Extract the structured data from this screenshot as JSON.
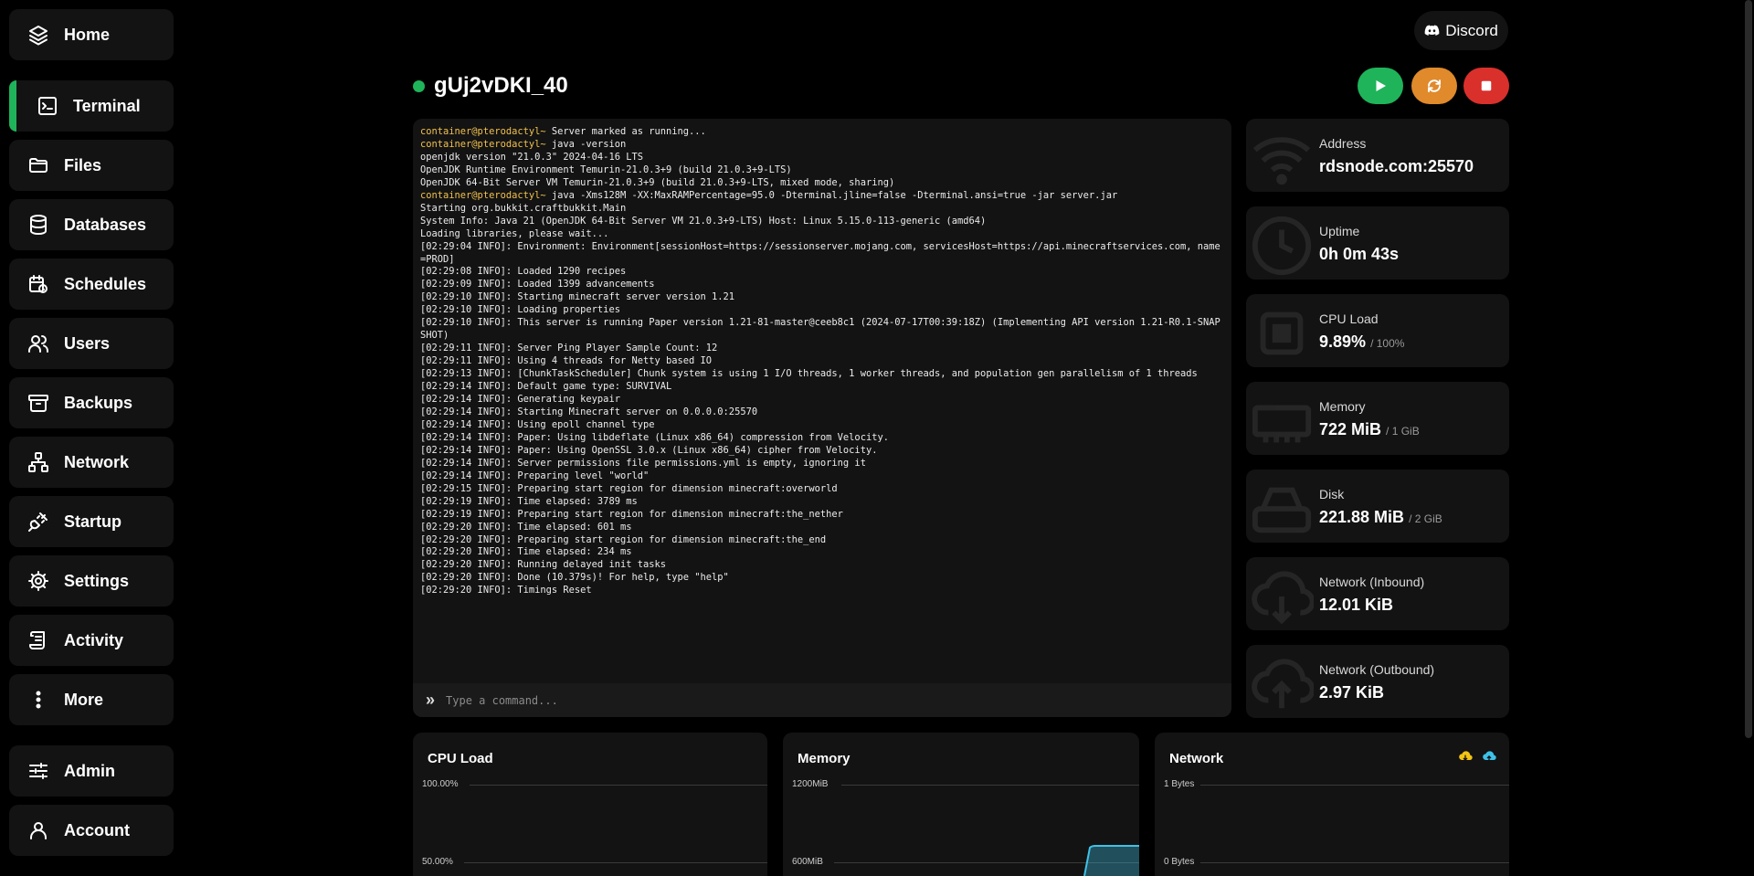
{
  "sidebar": {
    "items": [
      {
        "label": "Home",
        "icon": "layers-icon"
      },
      {
        "label": "Terminal",
        "icon": "terminal-icon",
        "active": true
      },
      {
        "label": "Files",
        "icon": "folder-icon"
      },
      {
        "label": "Databases",
        "icon": "database-icon"
      },
      {
        "label": "Schedules",
        "icon": "calendar-clock-icon"
      },
      {
        "label": "Users",
        "icon": "users-icon"
      },
      {
        "label": "Backups",
        "icon": "archive-icon"
      },
      {
        "label": "Network",
        "icon": "network-icon"
      },
      {
        "label": "Startup",
        "icon": "plug-icon"
      },
      {
        "label": "Settings",
        "icon": "gear-icon"
      },
      {
        "label": "Activity",
        "icon": "scroll-icon"
      },
      {
        "label": "More",
        "icon": "more-vertical-icon"
      },
      {
        "label": "Admin",
        "icon": "sliders-icon"
      },
      {
        "label": "Account",
        "icon": "user-icon"
      }
    ]
  },
  "header": {
    "discord_label": "Discord",
    "server_name": "gUj2vDKI_40",
    "status_color": "#1fb45a"
  },
  "power": {
    "start_color": "#1fb45a",
    "restart_color": "#e08a2c",
    "stop_color": "#d9302c"
  },
  "terminal": {
    "lines": [
      {
        "prompt": "container@pterodactyl~",
        "text": " Server marked as running..."
      },
      {
        "prompt": "container@pterodactyl~",
        "text": " java -version"
      },
      {
        "text": "openjdk version \"21.0.3\" 2024-04-16 LTS"
      },
      {
        "text": "OpenJDK Runtime Environment Temurin-21.0.3+9 (build 21.0.3+9-LTS)"
      },
      {
        "text": "OpenJDK 64-Bit Server VM Temurin-21.0.3+9 (build 21.0.3+9-LTS, mixed mode, sharing)"
      },
      {
        "prompt": "container@pterodactyl~",
        "text": " java -Xms128M -XX:MaxRAMPercentage=95.0 -Dterminal.jline=false -Dterminal.ansi=true -jar server.jar"
      },
      {
        "text": "Starting org.bukkit.craftbukkit.Main"
      },
      {
        "text": "System Info: Java 21 (OpenJDK 64-Bit Server VM 21.0.3+9-LTS) Host: Linux 5.15.0-113-generic (amd64)"
      },
      {
        "text": "Loading libraries, please wait..."
      },
      {
        "text": "[02:29:04 INFO]: Environment: Environment[sessionHost=https://sessionserver.mojang.com, servicesHost=https://api.minecraftservices.com, name=PROD]"
      },
      {
        "text": "[02:29:08 INFO]: Loaded 1290 recipes"
      },
      {
        "text": "[02:29:09 INFO]: Loaded 1399 advancements"
      },
      {
        "text": "[02:29:10 INFO]: Starting minecraft server version 1.21"
      },
      {
        "text": "[02:29:10 INFO]: Loading properties"
      },
      {
        "text": "[02:29:10 INFO]: This server is running Paper version 1.21-81-master@ceeb8c1 (2024-07-17T00:39:18Z) (Implementing API version 1.21-R0.1-SNAPSHOT)"
      },
      {
        "text": "[02:29:11 INFO]: Server Ping Player Sample Count: 12"
      },
      {
        "text": "[02:29:11 INFO]: Using 4 threads for Netty based IO"
      },
      {
        "text": "[02:29:13 INFO]: [ChunkTaskScheduler] Chunk system is using 1 I/O threads, 1 worker threads, and population gen parallelism of 1 threads"
      },
      {
        "text": "[02:29:14 INFO]: Default game type: SURVIVAL"
      },
      {
        "text": "[02:29:14 INFO]: Generating keypair"
      },
      {
        "text": "[02:29:14 INFO]: Starting Minecraft server on 0.0.0.0:25570"
      },
      {
        "text": "[02:29:14 INFO]: Using epoll channel type"
      },
      {
        "text": "[02:29:14 INFO]: Paper: Using libdeflate (Linux x86_64) compression from Velocity."
      },
      {
        "text": "[02:29:14 INFO]: Paper: Using OpenSSL 3.0.x (Linux x86_64) cipher from Velocity."
      },
      {
        "text": "[02:29:14 INFO]: Server permissions file permissions.yml is empty, ignoring it"
      },
      {
        "text": "[02:29:14 INFO]: Preparing level \"world\""
      },
      {
        "text": "[02:29:15 INFO]: Preparing start region for dimension minecraft:overworld"
      },
      {
        "text": "[02:29:19 INFO]: Time elapsed: 3789 ms"
      },
      {
        "text": "[02:29:19 INFO]: Preparing start region for dimension minecraft:the_nether"
      },
      {
        "text": "[02:29:20 INFO]: Time elapsed: 601 ms"
      },
      {
        "text": "[02:29:20 INFO]: Preparing start region for dimension minecraft:the_end"
      },
      {
        "text": "[02:29:20 INFO]: Time elapsed: 234 ms"
      },
      {
        "text": "[02:29:20 INFO]: Running delayed init tasks"
      },
      {
        "text": "[02:29:20 INFO]: Done (10.379s)! For help, type \"help\""
      },
      {
        "text": "[02:29:20 INFO]: Timings Reset"
      }
    ],
    "input_placeholder": "Type a command..."
  },
  "stats": {
    "address": {
      "label": "Address",
      "value": "rdsnode.com:25570",
      "icon": "wifi-icon"
    },
    "uptime": {
      "label": "Uptime",
      "value": "0h 0m 43s",
      "icon": "clock-icon"
    },
    "cpu": {
      "label": "CPU Load",
      "value": "9.89%",
      "max": "/ 100%",
      "icon": "cpu-icon"
    },
    "memory": {
      "label": "Memory",
      "value": "722 MiB",
      "max": "/ 1 GiB",
      "icon": "memory-icon"
    },
    "disk": {
      "label": "Disk",
      "value": "221.88 MiB",
      "max": "/ 2 GiB",
      "icon": "hard-drive-icon"
    },
    "net_in": {
      "label": "Network (Inbound)",
      "value": "12.01 KiB",
      "icon": "cloud-download-icon"
    },
    "net_out": {
      "label": "Network (Outbound)",
      "value": "2.97 KiB",
      "icon": "cloud-upload-icon"
    }
  },
  "graphs": {
    "cpu": {
      "title": "CPU Load",
      "ticks": [
        "100.00%",
        "50.00%"
      ]
    },
    "memory": {
      "title": "Memory",
      "ticks": [
        "1200MiB",
        "600MiB"
      ]
    },
    "network": {
      "title": "Network",
      "ticks": [
        "1 Bytes",
        "0 Bytes"
      ],
      "inbound_color": "#f2c414",
      "outbound_color": "#3fc1e6"
    }
  }
}
